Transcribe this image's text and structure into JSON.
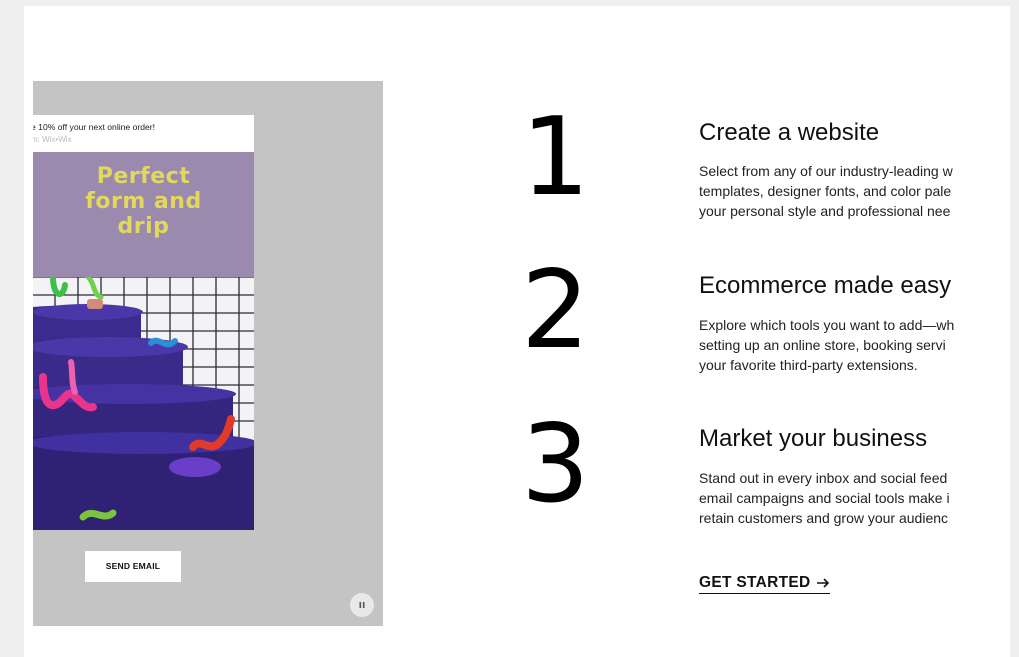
{
  "email_preview": {
    "subject": "e 10% off your next online order!",
    "from": "m: Wix•Wix",
    "hero_text": "Perfect\nform and\ndrip",
    "send_button": "SEND EMAIL",
    "pause_icon": "pause-icon"
  },
  "steps": [
    {
      "number": "1",
      "title": "Create a website",
      "lines": [
        "Select from any of our industry-leading w",
        "templates, designer fonts, and color pale",
        "your personal style and professional nee"
      ]
    },
    {
      "number": "2",
      "title": "Ecommerce made easy",
      "lines": [
        "Explore which tools you want to add—wh",
        "setting up an online store, booking servi",
        "your favorite third-party extensions."
      ]
    },
    {
      "number": "3",
      "title": "Market your business",
      "lines": [
        "Stand out in every inbox and social feed",
        "email campaigns and social tools make i",
        "retain customers and grow your audienc"
      ]
    }
  ],
  "cta": {
    "label": "GET STARTED",
    "icon": "arrow-right-icon"
  },
  "colors": {
    "hero_bg": "#9b8aad",
    "hero_text": "#e2d85d",
    "scene_purple": "#3a2a8c",
    "panel_bg": "#c4c4c4"
  }
}
